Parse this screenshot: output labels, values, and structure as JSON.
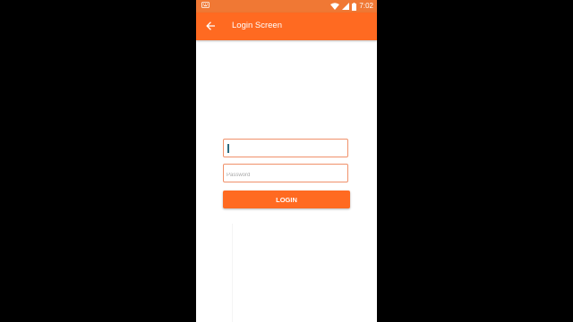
{
  "status_bar": {
    "left_icon": "keyboard-icon",
    "time": "7:02",
    "icons": [
      "wifi-icon",
      "signal-icon",
      "battery-icon"
    ]
  },
  "app_bar": {
    "back_icon": "arrow-left-icon",
    "title": "Login Screen"
  },
  "form": {
    "username": {
      "value": "",
      "placeholder": ""
    },
    "password": {
      "value": "",
      "placeholder": "Password"
    },
    "login_label": "LOGIN"
  },
  "colors": {
    "accent": "#ff6a21",
    "status_bar": "#f07834",
    "field_border": "#f0916a"
  }
}
